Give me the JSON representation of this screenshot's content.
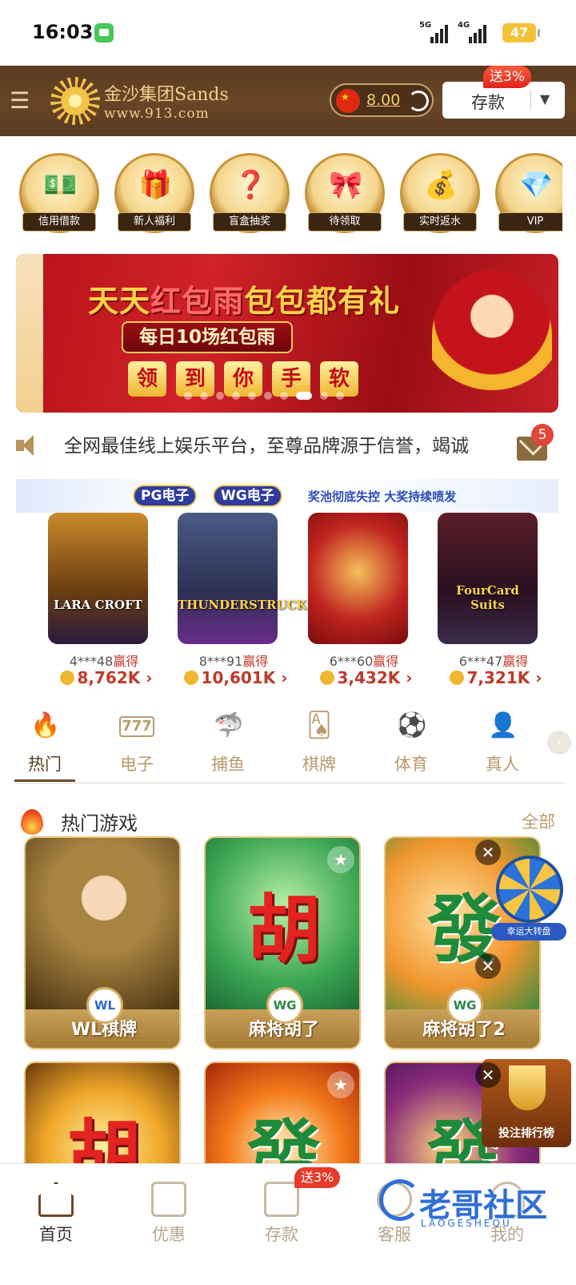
{
  "status_bar": {
    "time": "16:03",
    "net1": "5G",
    "net2": "4G",
    "battery": "47"
  },
  "header": {
    "logo_name": "金沙集团Sands",
    "logo_url": "www.913.com",
    "balance": "8.00",
    "deposit_label": "存款",
    "deposit_badge": "送3%"
  },
  "quick_menu": [
    {
      "label": "信用借款",
      "icon": "cash-hand-icon"
    },
    {
      "label": "新人福利",
      "icon": "gift-box-icon"
    },
    {
      "label": "盲盒抽奖",
      "icon": "mystery-box-icon"
    },
    {
      "label": "待领取",
      "icon": "gift-hand-icon"
    },
    {
      "label": "实时返水",
      "icon": "money-bag-icon"
    },
    {
      "label": "VIP",
      "icon": "vip-diamond-icon"
    }
  ],
  "banner": {
    "title_a": "天天",
    "title_b": "红包雨",
    "title_c": "包包都有礼",
    "subtitle": "每日10场红包雨",
    "chars": [
      "领",
      "到",
      "你",
      "手",
      "软"
    ]
  },
  "notice": {
    "text": "全网最佳线上娱乐平台，至尊品牌源于信誉，竭诚",
    "mail_count": "5"
  },
  "winners": {
    "pill_pg": "PG电子",
    "pill_wg": "WG电子",
    "slogan": "奖池彻底失控 大奖持续喷发",
    "items": [
      {
        "game": "LARA CROFT",
        "user": "4***48",
        "won": "赢得",
        "amount": "8,762K"
      },
      {
        "game": "THUNDERSTRUCK",
        "user": "8***91",
        "won": "赢得",
        "amount": "10,601K"
      },
      {
        "game": "",
        "user": "6***60",
        "won": "赢得",
        "amount": "3,432K"
      },
      {
        "game": "FourCard Suits",
        "user": "6***47",
        "won": "赢得",
        "amount": "7,321K"
      }
    ]
  },
  "categories": [
    {
      "label": "热门",
      "icon": "fire-icon"
    },
    {
      "label": "电子",
      "icon": "slot-777-icon"
    },
    {
      "label": "捕鱼",
      "icon": "shark-icon"
    },
    {
      "label": "棋牌",
      "icon": "cards-icon"
    },
    {
      "label": "体育",
      "icon": "soccer-ball-icon"
    },
    {
      "label": "真人",
      "icon": "dealer-icon"
    }
  ],
  "hot": {
    "title": "热门游戏",
    "all": "全部",
    "games": [
      {
        "name": "WL棋牌",
        "provider": "WL",
        "glyph": ""
      },
      {
        "name": "麻将胡了",
        "provider": "WG",
        "glyph": "胡"
      },
      {
        "name": "麻将胡了2",
        "provider": "WG",
        "glyph": "發"
      },
      {
        "name": "",
        "provider": "",
        "glyph": "胡"
      },
      {
        "name": "",
        "provider": "",
        "glyph": "發"
      },
      {
        "name": "",
        "provider": "",
        "glyph": "發"
      }
    ]
  },
  "floats": {
    "wheel_label": "幸运大转盘",
    "trophy_label": "投注排行榜"
  },
  "bottom_nav": [
    {
      "label": "首页",
      "icon": "home-icon"
    },
    {
      "label": "优惠",
      "icon": "gift-icon"
    },
    {
      "label": "存款",
      "icon": "wallet-icon"
    },
    {
      "label": "客服",
      "icon": "headset-icon"
    },
    {
      "label": "我的",
      "icon": "user-icon"
    }
  ],
  "bottom_badge": "送3%",
  "watermark": {
    "main": "老哥社区",
    "sub": "LAOGESHEQU"
  },
  "colors": {
    "brand_brown": "#5b3a20",
    "gold": "#b89a70",
    "accent_red": "#e0231b"
  }
}
